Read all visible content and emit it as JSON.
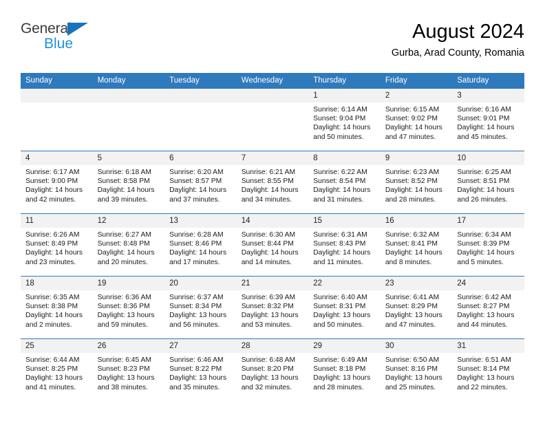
{
  "brand": {
    "line1": "General",
    "line2": "Blue",
    "triangle_color": "#1673bf",
    "blue_text_color": "#1f8fe0"
  },
  "header": {
    "title": "August 2024",
    "location": "Gurba, Arad County, Romania"
  },
  "theme": {
    "header_blue": "#2f79bd",
    "daynum_band": "#f2f2f2",
    "page_background": "#ffffff"
  },
  "weekday_headers": [
    "Sunday",
    "Monday",
    "Tuesday",
    "Wednesday",
    "Thursday",
    "Friday",
    "Saturday"
  ],
  "weeks": [
    [
      {
        "day": "",
        "sunrise": "",
        "sunset": "",
        "daylight_line1": "",
        "daylight_line2": ""
      },
      {
        "day": "",
        "sunrise": "",
        "sunset": "",
        "daylight_line1": "",
        "daylight_line2": ""
      },
      {
        "day": "",
        "sunrise": "",
        "sunset": "",
        "daylight_line1": "",
        "daylight_line2": ""
      },
      {
        "day": "",
        "sunrise": "",
        "sunset": "",
        "daylight_line1": "",
        "daylight_line2": ""
      },
      {
        "day": "1",
        "sunrise": "Sunrise: 6:14 AM",
        "sunset": "Sunset: 9:04 PM",
        "daylight_line1": "Daylight: 14 hours",
        "daylight_line2": "and 50 minutes."
      },
      {
        "day": "2",
        "sunrise": "Sunrise: 6:15 AM",
        "sunset": "Sunset: 9:02 PM",
        "daylight_line1": "Daylight: 14 hours",
        "daylight_line2": "and 47 minutes."
      },
      {
        "day": "3",
        "sunrise": "Sunrise: 6:16 AM",
        "sunset": "Sunset: 9:01 PM",
        "daylight_line1": "Daylight: 14 hours",
        "daylight_line2": "and 45 minutes."
      }
    ],
    [
      {
        "day": "4",
        "sunrise": "Sunrise: 6:17 AM",
        "sunset": "Sunset: 9:00 PM",
        "daylight_line1": "Daylight: 14 hours",
        "daylight_line2": "and 42 minutes."
      },
      {
        "day": "5",
        "sunrise": "Sunrise: 6:18 AM",
        "sunset": "Sunset: 8:58 PM",
        "daylight_line1": "Daylight: 14 hours",
        "daylight_line2": "and 39 minutes."
      },
      {
        "day": "6",
        "sunrise": "Sunrise: 6:20 AM",
        "sunset": "Sunset: 8:57 PM",
        "daylight_line1": "Daylight: 14 hours",
        "daylight_line2": "and 37 minutes."
      },
      {
        "day": "7",
        "sunrise": "Sunrise: 6:21 AM",
        "sunset": "Sunset: 8:55 PM",
        "daylight_line1": "Daylight: 14 hours",
        "daylight_line2": "and 34 minutes."
      },
      {
        "day": "8",
        "sunrise": "Sunrise: 6:22 AM",
        "sunset": "Sunset: 8:54 PM",
        "daylight_line1": "Daylight: 14 hours",
        "daylight_line2": "and 31 minutes."
      },
      {
        "day": "9",
        "sunrise": "Sunrise: 6:23 AM",
        "sunset": "Sunset: 8:52 PM",
        "daylight_line1": "Daylight: 14 hours",
        "daylight_line2": "and 28 minutes."
      },
      {
        "day": "10",
        "sunrise": "Sunrise: 6:25 AM",
        "sunset": "Sunset: 8:51 PM",
        "daylight_line1": "Daylight: 14 hours",
        "daylight_line2": "and 26 minutes."
      }
    ],
    [
      {
        "day": "11",
        "sunrise": "Sunrise: 6:26 AM",
        "sunset": "Sunset: 8:49 PM",
        "daylight_line1": "Daylight: 14 hours",
        "daylight_line2": "and 23 minutes."
      },
      {
        "day": "12",
        "sunrise": "Sunrise: 6:27 AM",
        "sunset": "Sunset: 8:48 PM",
        "daylight_line1": "Daylight: 14 hours",
        "daylight_line2": "and 20 minutes."
      },
      {
        "day": "13",
        "sunrise": "Sunrise: 6:28 AM",
        "sunset": "Sunset: 8:46 PM",
        "daylight_line1": "Daylight: 14 hours",
        "daylight_line2": "and 17 minutes."
      },
      {
        "day": "14",
        "sunrise": "Sunrise: 6:30 AM",
        "sunset": "Sunset: 8:44 PM",
        "daylight_line1": "Daylight: 14 hours",
        "daylight_line2": "and 14 minutes."
      },
      {
        "day": "15",
        "sunrise": "Sunrise: 6:31 AM",
        "sunset": "Sunset: 8:43 PM",
        "daylight_line1": "Daylight: 14 hours",
        "daylight_line2": "and 11 minutes."
      },
      {
        "day": "16",
        "sunrise": "Sunrise: 6:32 AM",
        "sunset": "Sunset: 8:41 PM",
        "daylight_line1": "Daylight: 14 hours",
        "daylight_line2": "and 8 minutes."
      },
      {
        "day": "17",
        "sunrise": "Sunrise: 6:34 AM",
        "sunset": "Sunset: 8:39 PM",
        "daylight_line1": "Daylight: 14 hours",
        "daylight_line2": "and 5 minutes."
      }
    ],
    [
      {
        "day": "18",
        "sunrise": "Sunrise: 6:35 AM",
        "sunset": "Sunset: 8:38 PM",
        "daylight_line1": "Daylight: 14 hours",
        "daylight_line2": "and 2 minutes."
      },
      {
        "day": "19",
        "sunrise": "Sunrise: 6:36 AM",
        "sunset": "Sunset: 8:36 PM",
        "daylight_line1": "Daylight: 13 hours",
        "daylight_line2": "and 59 minutes."
      },
      {
        "day": "20",
        "sunrise": "Sunrise: 6:37 AM",
        "sunset": "Sunset: 8:34 PM",
        "daylight_line1": "Daylight: 13 hours",
        "daylight_line2": "and 56 minutes."
      },
      {
        "day": "21",
        "sunrise": "Sunrise: 6:39 AM",
        "sunset": "Sunset: 8:32 PM",
        "daylight_line1": "Daylight: 13 hours",
        "daylight_line2": "and 53 minutes."
      },
      {
        "day": "22",
        "sunrise": "Sunrise: 6:40 AM",
        "sunset": "Sunset: 8:31 PM",
        "daylight_line1": "Daylight: 13 hours",
        "daylight_line2": "and 50 minutes."
      },
      {
        "day": "23",
        "sunrise": "Sunrise: 6:41 AM",
        "sunset": "Sunset: 8:29 PM",
        "daylight_line1": "Daylight: 13 hours",
        "daylight_line2": "and 47 minutes."
      },
      {
        "day": "24",
        "sunrise": "Sunrise: 6:42 AM",
        "sunset": "Sunset: 8:27 PM",
        "daylight_line1": "Daylight: 13 hours",
        "daylight_line2": "and 44 minutes."
      }
    ],
    [
      {
        "day": "25",
        "sunrise": "Sunrise: 6:44 AM",
        "sunset": "Sunset: 8:25 PM",
        "daylight_line1": "Daylight: 13 hours",
        "daylight_line2": "and 41 minutes."
      },
      {
        "day": "26",
        "sunrise": "Sunrise: 6:45 AM",
        "sunset": "Sunset: 8:23 PM",
        "daylight_line1": "Daylight: 13 hours",
        "daylight_line2": "and 38 minutes."
      },
      {
        "day": "27",
        "sunrise": "Sunrise: 6:46 AM",
        "sunset": "Sunset: 8:22 PM",
        "daylight_line1": "Daylight: 13 hours",
        "daylight_line2": "and 35 minutes."
      },
      {
        "day": "28",
        "sunrise": "Sunrise: 6:48 AM",
        "sunset": "Sunset: 8:20 PM",
        "daylight_line1": "Daylight: 13 hours",
        "daylight_line2": "and 32 minutes."
      },
      {
        "day": "29",
        "sunrise": "Sunrise: 6:49 AM",
        "sunset": "Sunset: 8:18 PM",
        "daylight_line1": "Daylight: 13 hours",
        "daylight_line2": "and 28 minutes."
      },
      {
        "day": "30",
        "sunrise": "Sunrise: 6:50 AM",
        "sunset": "Sunset: 8:16 PM",
        "daylight_line1": "Daylight: 13 hours",
        "daylight_line2": "and 25 minutes."
      },
      {
        "day": "31",
        "sunrise": "Sunrise: 6:51 AM",
        "sunset": "Sunset: 8:14 PM",
        "daylight_line1": "Daylight: 13 hours",
        "daylight_line2": "and 22 minutes."
      }
    ]
  ]
}
